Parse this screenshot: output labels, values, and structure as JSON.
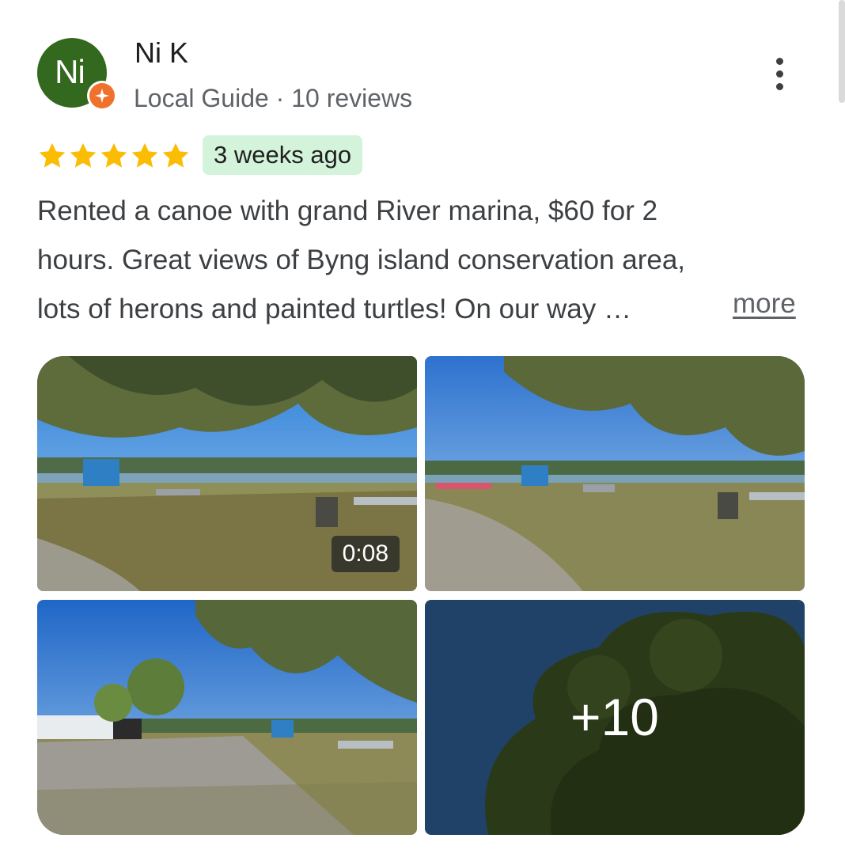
{
  "reviewer": {
    "initials": "Ni",
    "name": "Ni K",
    "meta": "Local Guide · 10 reviews",
    "avatar_color": "#33691e",
    "badge_color": "#f0712c"
  },
  "review": {
    "rating": 5,
    "rating_max": 5,
    "star_color": "#fbbc04",
    "time_ago": "3 weeks ago",
    "text_lines": [
      "Rented a canoe with grand River marina, $60 for 2",
      "hours. Great views of Byng island conservation area,",
      "lots of herons and painted turtles! On our way …"
    ],
    "more_label": "more"
  },
  "photos": {
    "video_duration": "0:08",
    "more_count": "+10"
  },
  "icons": {
    "menu": "more-vert-icon",
    "badge": "local-guide-star-icon",
    "star": "star-icon"
  }
}
